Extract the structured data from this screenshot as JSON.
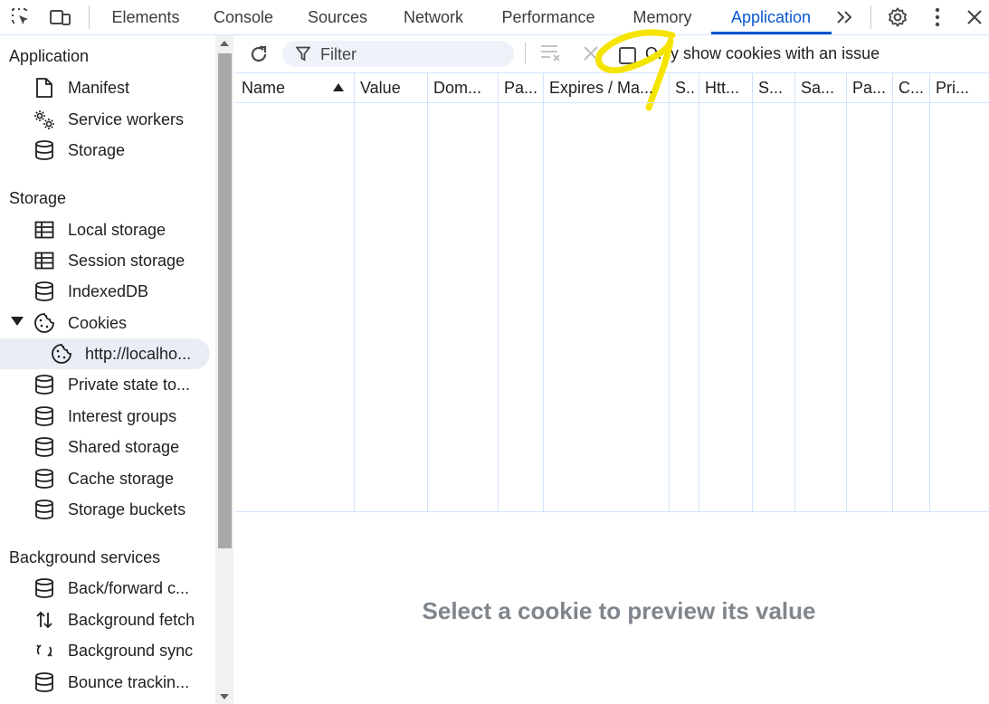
{
  "toolbar": {
    "tabs": [
      {
        "label": "Elements"
      },
      {
        "label": "Console"
      },
      {
        "label": "Sources"
      },
      {
        "label": "Network"
      },
      {
        "label": "Performance"
      },
      {
        "label": "Memory"
      },
      {
        "label": "Application",
        "active": true
      }
    ],
    "icons": [
      "inspect-element-icon",
      "device-toggle-icon",
      "more-tabs-icon",
      "settings-gear-icon",
      "more-options-icon",
      "close-icon"
    ]
  },
  "sidebar": {
    "sections": [
      {
        "heading": "Application",
        "items": [
          {
            "label": "Manifest",
            "icon": "document-icon"
          },
          {
            "label": "Service workers",
            "icon": "gears-icon"
          },
          {
            "label": "Storage",
            "icon": "database-icon"
          }
        ]
      },
      {
        "heading": "Storage",
        "items": [
          {
            "label": "Local storage",
            "icon": "table-icon"
          },
          {
            "label": "Session storage",
            "icon": "table-icon"
          },
          {
            "label": "IndexedDB",
            "icon": "database-icon"
          },
          {
            "label": "Cookies",
            "icon": "cookie-icon",
            "expanded": true
          },
          {
            "label": "http://localho...",
            "icon": "cookie-icon",
            "selected": true
          },
          {
            "label": "Private state to...",
            "icon": "database-icon"
          },
          {
            "label": "Interest groups",
            "icon": "database-icon"
          },
          {
            "label": "Shared storage",
            "icon": "database-icon"
          },
          {
            "label": "Cache storage",
            "icon": "database-icon"
          },
          {
            "label": "Storage buckets",
            "icon": "database-icon"
          }
        ]
      },
      {
        "heading": "Background services",
        "items": [
          {
            "label": "Back/forward c...",
            "icon": "database-icon"
          },
          {
            "label": "Background fetch",
            "icon": "up-down-arrows-icon"
          },
          {
            "label": "Background sync",
            "icon": "sync-icon"
          },
          {
            "label": "Bounce trackin...",
            "icon": "database-icon"
          }
        ]
      }
    ]
  },
  "cookies_panel": {
    "filter_placeholder": "Filter",
    "only_issues_label": "Only show cookies with an issue",
    "only_issues_checked": false,
    "columns": [
      "Name",
      "Value",
      "Dom...",
      "Pa...",
      "Expires / Ma...",
      "S..",
      "Htt...",
      "S...",
      "Sa...",
      "Pa...",
      "C...",
      "Pri..."
    ],
    "sorted_column": "Name",
    "rows": [],
    "preview_message": "Select a cookie to preview its value"
  },
  "colors": {
    "accent": "#0b57d0",
    "highlight": "#f5e400",
    "border": "#d3e3fd",
    "selected_bg": "#e9eef6"
  }
}
